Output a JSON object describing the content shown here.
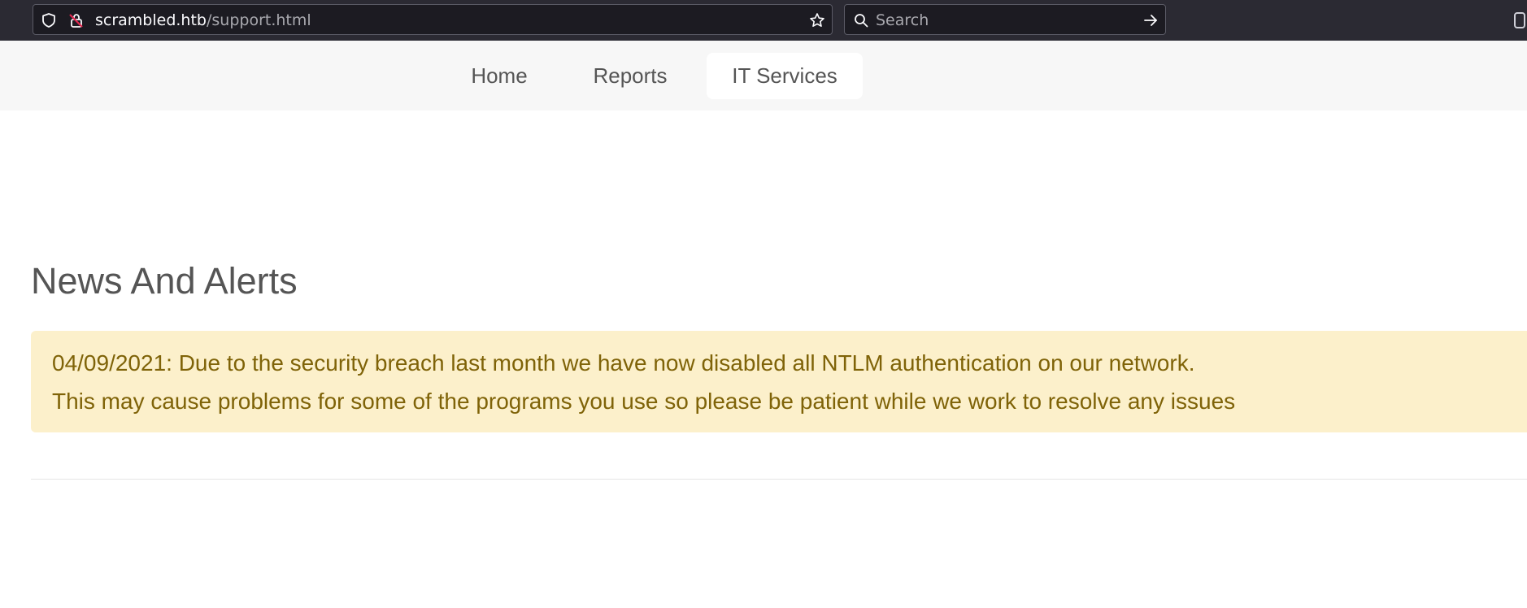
{
  "browser": {
    "url_host": "scrambled.htb",
    "url_path": "/support.html",
    "search_placeholder": "Search",
    "icons": [
      "shield-icon",
      "insecure-lock-icon",
      "bookmark-star-icon",
      "search-icon",
      "go-arrow-icon",
      "extension-icon"
    ]
  },
  "nav": {
    "items": [
      {
        "label": "Home",
        "active": false
      },
      {
        "label": "Reports",
        "active": false
      },
      {
        "label": "IT Services",
        "active": true
      }
    ]
  },
  "main": {
    "title": "News And Alerts",
    "alert": {
      "line1": "04/09/2021: Due to the security breach last month we have now disabled all NTLM authentication on our network.",
      "line2": "This may cause problems for some of the programs you use so please be patient while we work to resolve any issues"
    }
  },
  "colors": {
    "toolbar": "#2b2a33",
    "nav_bg": "#f7f7f7",
    "alert_bg": "#fcf0cb",
    "alert_text": "#7f6308",
    "heading_text": "#555555"
  }
}
